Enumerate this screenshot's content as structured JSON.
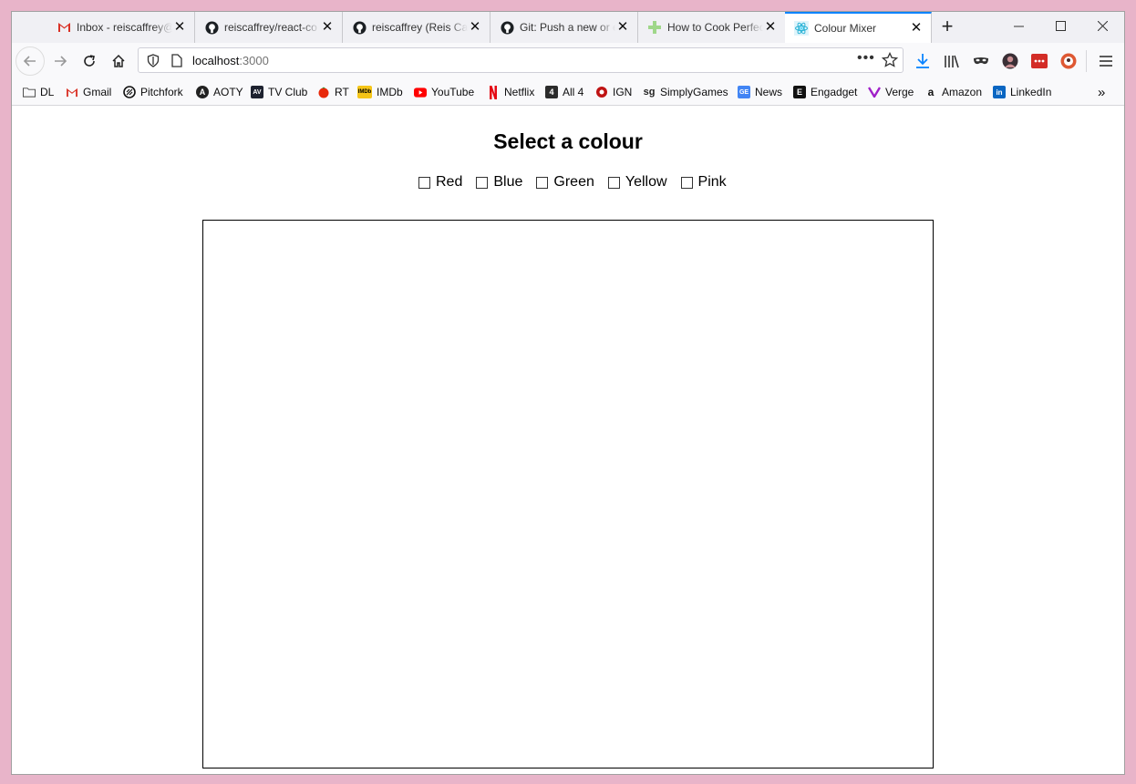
{
  "browser": {
    "tabs": [
      {
        "title": "Inbox - reiscaffrey@",
        "icon": "gmail-icon"
      },
      {
        "title": "reiscaffrey/react-co",
        "icon": "github-icon"
      },
      {
        "title": "reiscaffrey (Reis Caf",
        "icon": "github-icon"
      },
      {
        "title": "Git: Push a new or e",
        "icon": "github-icon"
      },
      {
        "title": "How to Cook Perfect",
        "icon": "plus-green-icon"
      },
      {
        "title": "Colour Mixer",
        "icon": "react-icon",
        "active": true
      }
    ],
    "url_host": "localhost",
    "url_port": ":3000",
    "bookmarks": [
      {
        "label": "DL",
        "icon": "folder-icon"
      },
      {
        "label": "Gmail",
        "icon": "gmail-icon"
      },
      {
        "label": "Pitchfork",
        "icon": "pitchfork-icon"
      },
      {
        "label": "AOTY",
        "icon": "aoty-icon"
      },
      {
        "label": "TV Club",
        "icon": "av-icon"
      },
      {
        "label": "RT",
        "icon": "tomato-icon"
      },
      {
        "label": "IMDb",
        "icon": "imdb-icon"
      },
      {
        "label": "YouTube",
        "icon": "youtube-icon"
      },
      {
        "label": "Netflix",
        "icon": "netflix-icon"
      },
      {
        "label": "All 4",
        "icon": "all4-icon"
      },
      {
        "label": "IGN",
        "icon": "ign-icon"
      },
      {
        "label": "SimplyGames",
        "icon": "simplygames-icon"
      },
      {
        "label": "News",
        "icon": "news-icon"
      },
      {
        "label": "Engadget",
        "icon": "engadget-icon"
      },
      {
        "label": "Verge",
        "icon": "verge-icon"
      },
      {
        "label": "Amazon",
        "icon": "amazon-icon"
      },
      {
        "label": "LinkedIn",
        "icon": "linkedin-icon"
      }
    ]
  },
  "page": {
    "heading": "Select a colour",
    "options": [
      {
        "label": "Red",
        "checked": false
      },
      {
        "label": "Blue",
        "checked": false
      },
      {
        "label": "Green",
        "checked": false
      },
      {
        "label": "Yellow",
        "checked": false
      },
      {
        "label": "Pink",
        "checked": false
      }
    ]
  },
  "colors": {
    "desktop": "#e8b4c9",
    "accent": "#0a84ff"
  }
}
